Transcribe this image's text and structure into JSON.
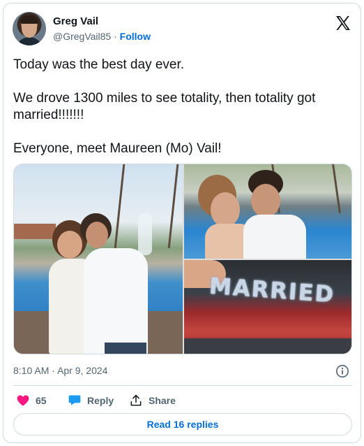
{
  "author": {
    "name": "Greg Vail",
    "handle": "@GregVail85",
    "separator": "·",
    "follow_label": "Follow"
  },
  "tweet": {
    "lines": [
      "Today was the best day ever.",
      "We drove 1300 miles to see totality, then totality got married!!!!!!!",
      "Everyone, meet Maureen (Mo) Vail!"
    ]
  },
  "media": {
    "photo_3_text": "MARRIED"
  },
  "meta": {
    "time": "8:10 AM",
    "separator": "·",
    "date": "Apr 9, 2024"
  },
  "actions": {
    "likes_count": "65",
    "reply_label": "Reply",
    "share_label": "Share"
  },
  "read_replies_label": "Read 16 replies",
  "colors": {
    "like": "#f91880",
    "reply_icon": "#1d9bf0",
    "link": "#006fd6",
    "text_secondary": "#536471",
    "border": "#cfd9de"
  },
  "icons": [
    "x-logo-icon",
    "info-icon",
    "heart-icon",
    "reply-bubble-icon",
    "share-icon"
  ]
}
